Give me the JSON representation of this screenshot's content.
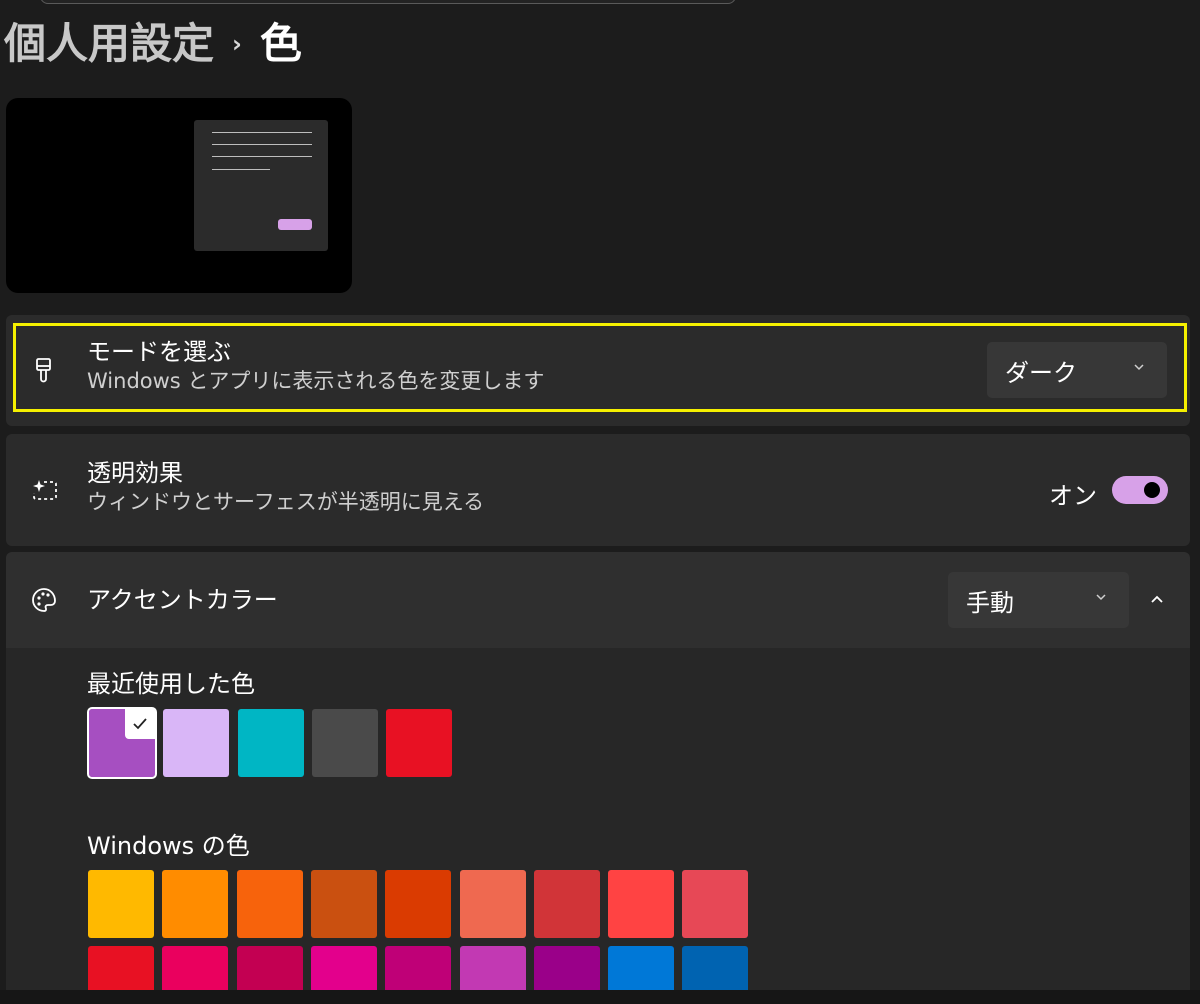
{
  "breadcrumb": {
    "parent": "個人用設定",
    "separator": "›",
    "current": "色"
  },
  "preview": {
    "accent_button_color": "#d7a1e8"
  },
  "mode_setting": {
    "title": "モードを選ぶ",
    "description": "Windows とアプリに表示される色を変更します",
    "icon": "brush-icon",
    "selected_value": "ダーク"
  },
  "transparency_setting": {
    "title": "透明効果",
    "description": "ウィンドウとサーフェスが半透明に見える",
    "icon": "transparency-sparkle-icon",
    "toggle_label": "オン",
    "toggle_on": true,
    "toggle_color": "#d7a1e8"
  },
  "accent_setting": {
    "title": "アクセントカラー",
    "icon": "palette-icon",
    "selected_value": "手動",
    "expanded": true
  },
  "recent_colors": {
    "label": "最近使用した色",
    "colors": [
      "#a64fc1",
      "#d9b6f7",
      "#00b6c4",
      "#4a4a4a",
      "#e81123"
    ],
    "selected_index": 0
  },
  "windows_colors": {
    "label": "Windows の色",
    "row1": [
      "#ffb900",
      "#ff8c00",
      "#f7630c",
      "#ca5010",
      "#da3b01",
      "#ef6950",
      "#d13438",
      "#ff4343",
      "#e74856"
    ],
    "row2": [
      "#e81123",
      "#ea005e",
      "#c30052",
      "#e3008c",
      "#bf0077",
      "#c239b3",
      "#9a0089",
      "#0078d7",
      "#0063b1"
    ]
  }
}
